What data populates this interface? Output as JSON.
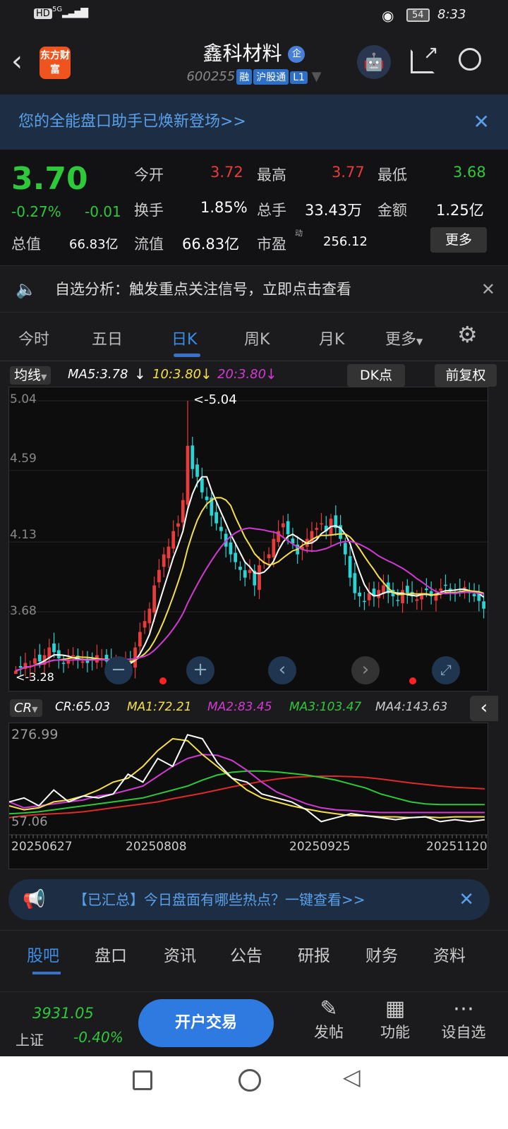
{
  "status": {
    "time": "8:33",
    "battery": "54",
    "network": "5G",
    "hd": "HD"
  },
  "header": {
    "logo": "东方财富",
    "title": "鑫科材料",
    "badge": "企",
    "code": "600255",
    "tags": [
      "融",
      "沪股通",
      "L1"
    ]
  },
  "banner": {
    "text": "您的全能盘口助手已焕新登场>>"
  },
  "quote": {
    "price": "3.70",
    "pct": "-0.27%",
    "chg": "-0.01",
    "open_label": "今开",
    "open": "3.72",
    "high_label": "最高",
    "high": "3.77",
    "low_label": "最低",
    "low": "3.68",
    "turnover_label": "换手",
    "turnover": "1.85%",
    "vol_label": "总手",
    "vol": "33.43万",
    "amt_label": "金额",
    "amt": "1.25亿",
    "mcap_label": "总值",
    "mcap": "66.83亿",
    "float_label": "流值",
    "float": "66.83亿",
    "pe_label": "市盈",
    "pe_sup": "动",
    "pe": "256.12",
    "more": "更多"
  },
  "notice": {
    "text": "自选分析：触发重点关注信号，立即点击查看"
  },
  "tabs": [
    "今时",
    "五日",
    "日K",
    "周K",
    "月K",
    "更多"
  ],
  "indicator_bar": {
    "ma_select": "均线",
    "ma5": "MA5:3.78",
    "ma10": "10:3.80",
    "ma20": "20:3.80",
    "dk": "DK点",
    "adjust": "前复权"
  },
  "cr_bar": {
    "select": "CR",
    "cr": "CR:65.03",
    "ma1": "MA1:72.21",
    "ma2": "MA2:83.45",
    "ma3": "MA3:103.47",
    "ma4": "MA4:143.63"
  },
  "chart_data": [
    {
      "type": "candlestick",
      "y_ticks": [
        "5.04",
        "4.59",
        "4.13",
        "3.68"
      ],
      "ylim": [
        3.2,
        5.1
      ],
      "max_label": "<-5.04",
      "max": 5.04,
      "min_label": "<-3.28",
      "min": 3.28,
      "closes": [
        3.3,
        3.32,
        3.35,
        3.33,
        3.38,
        3.36,
        3.4,
        3.45,
        3.42,
        3.38,
        3.35,
        3.37,
        3.4,
        3.38,
        3.36,
        3.35,
        3.37,
        3.4,
        3.38,
        3.36,
        3.35,
        3.34,
        3.33,
        3.36,
        3.35,
        3.45,
        3.55,
        3.62,
        3.7,
        3.85,
        3.95,
        4.05,
        4.1,
        4.2,
        4.25,
        4.4,
        4.75,
        4.6,
        4.55,
        4.45,
        4.4,
        4.3,
        4.25,
        4.2,
        4.1,
        4.05,
        4.0,
        3.95,
        3.9,
        3.95,
        3.85,
        3.98,
        4.0,
        4.05,
        4.15,
        4.2,
        4.25,
        4.18,
        4.12,
        4.05,
        4.1,
        4.15,
        4.2,
        4.22,
        4.25,
        4.2,
        4.28,
        4.22,
        4.15,
        4.05,
        3.9,
        3.8,
        3.78,
        3.75,
        3.8,
        3.78,
        3.82,
        3.85,
        3.8,
        3.78,
        3.75,
        3.82,
        3.8,
        3.78,
        3.76,
        3.8,
        3.82,
        3.78,
        3.8,
        3.83,
        3.85,
        3.82,
        3.8,
        3.82,
        3.84,
        3.8,
        3.78,
        3.75,
        3.7
      ],
      "colors": {
        "up": "#e83b3b",
        "down": "#2ad4d4",
        "ma5": "#ffffff",
        "ma10": "#f5e04a",
        "ma20": "#d23ad2"
      }
    },
    {
      "type": "line",
      "name": "CR",
      "y_ticks": [
        "276.99",
        "57.06"
      ],
      "ylim": [
        40,
        300
      ],
      "x_labels": [
        "20250627",
        "20250808",
        "20250925",
        "20251120"
      ],
      "series": [
        {
          "name": "CR",
          "color": "#ffffff",
          "values": [
            110,
            120,
            100,
            140,
            110,
            125,
            120,
            130,
            180,
            160,
            220,
            200,
            280,
            270,
            210,
            170,
            160,
            130,
            120,
            110,
            90,
            60,
            70,
            80,
            75,
            70,
            65,
            70,
            72,
            60,
            65,
            60,
            65
          ]
        },
        {
          "name": "MA1",
          "color": "#f5e04a",
          "values": [
            100,
            90,
            95,
            110,
            115,
            125,
            140,
            160,
            170,
            200,
            240,
            270,
            265,
            230,
            200,
            170,
            140,
            120,
            110,
            100,
            92,
            85,
            80,
            75,
            75,
            72,
            72,
            70,
            72,
            70,
            72,
            72,
            72
          ]
        },
        {
          "name": "MA2",
          "color": "#d23ad2",
          "values": [
            110,
            95,
            100,
            105,
            110,
            115,
            125,
            130,
            140,
            150,
            175,
            200,
            220,
            230,
            228,
            215,
            190,
            160,
            135,
            120,
            105,
            95,
            90,
            88,
            85,
            83,
            83,
            83,
            83,
            83,
            83,
            83,
            83
          ]
        },
        {
          "name": "MA3",
          "color": "#2ec93a",
          "values": [
            80,
            82,
            85,
            90,
            95,
            100,
            105,
            110,
            115,
            120,
            130,
            140,
            150,
            165,
            178,
            185,
            188,
            188,
            186,
            182,
            178,
            172,
            165,
            155,
            145,
            130,
            120,
            110,
            105,
            103,
            103,
            103,
            103
          ]
        },
        {
          "name": "MA4",
          "color": "#e02a2a",
          "values": [
            70,
            75,
            78,
            80,
            82,
            85,
            90,
            95,
            100,
            105,
            110,
            118,
            125,
            132,
            140,
            148,
            155,
            162,
            168,
            172,
            174,
            175,
            175,
            174,
            172,
            168,
            163,
            158,
            154,
            150,
            147,
            145,
            143
          ]
        }
      ]
    }
  ],
  "bottom_notice": {
    "text": "【已汇总】今日盘面有哪些热点？一键查看>>"
  },
  "nav": [
    "股吧",
    "盘口",
    "资讯",
    "公告",
    "研报",
    "财务",
    "资料"
  ],
  "bottom": {
    "index_value": "3931.05",
    "index_name": "上证",
    "index_pct": "-0.40%",
    "trade": "开户交易",
    "post": "发帖",
    "func": "功能",
    "watch": "设自选"
  }
}
